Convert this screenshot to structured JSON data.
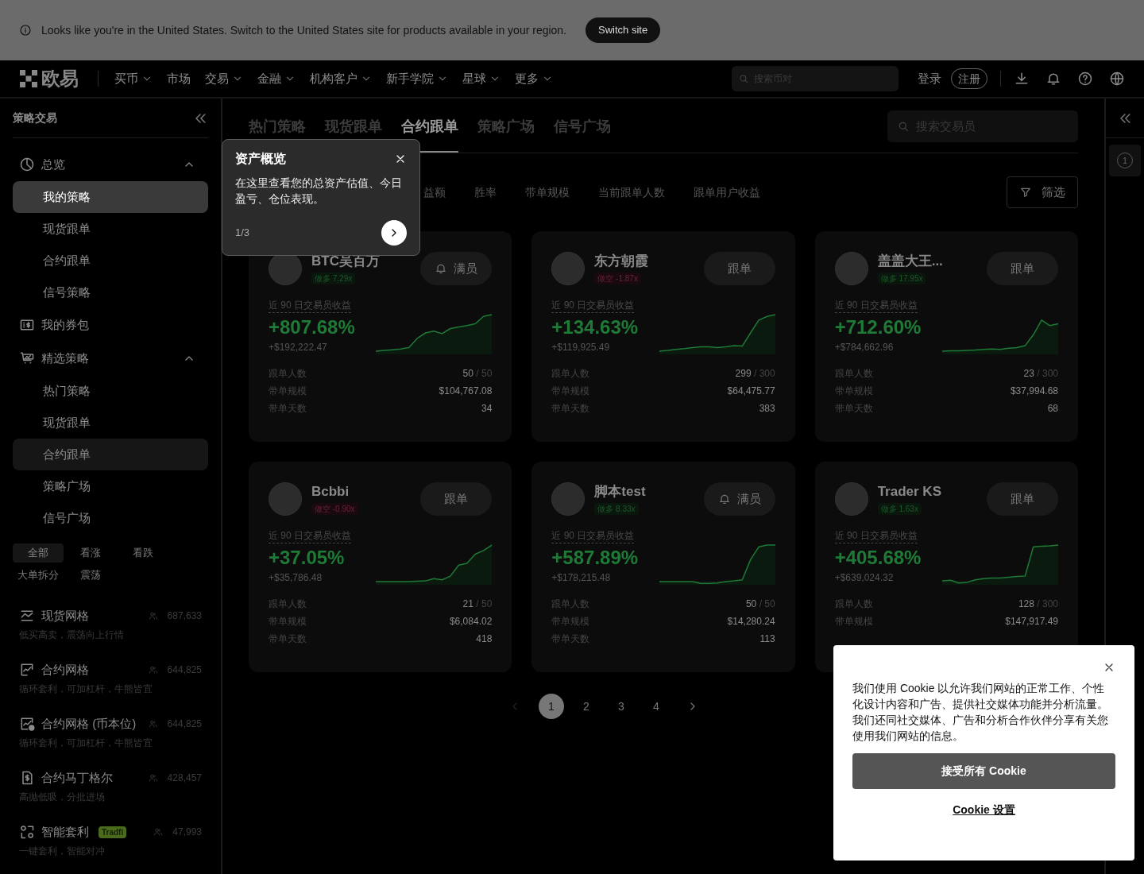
{
  "banner": {
    "message": "Looks like you're in the United States. Switch to the United States site for products available in your region.",
    "button": "Switch site"
  },
  "nav": {
    "logo": "欧易",
    "items": [
      {
        "label": "买币",
        "has_menu": true
      },
      {
        "label": "市场",
        "has_menu": false
      },
      {
        "label": "交易",
        "has_menu": true
      },
      {
        "label": "金融",
        "has_menu": true
      },
      {
        "label": "机构客户",
        "has_menu": true
      },
      {
        "label": "新手学院",
        "has_menu": true
      },
      {
        "label": "星球",
        "has_menu": true
      },
      {
        "label": "更多",
        "has_menu": true
      }
    ],
    "search": {
      "placeholder": "搜索币对"
    },
    "login": "登录",
    "register": "注册"
  },
  "sidebar": {
    "title": "策略交易",
    "groups": [
      {
        "label": "总览",
        "expanded": true,
        "children": [
          {
            "label": "我的策略",
            "selected": false,
            "spotlight": true
          },
          {
            "label": "现货跟单",
            "selected": false,
            "spotlight": false
          },
          {
            "label": "合约跟单",
            "selected": false,
            "spotlight": false
          },
          {
            "label": "信号策略",
            "selected": false,
            "spotlight": false
          }
        ]
      },
      {
        "label": "我的券包"
      },
      {
        "label": "精选策略",
        "expanded": true,
        "children": [
          {
            "label": "热门策略",
            "selected": false,
            "spotlight": false
          },
          {
            "label": "现货跟单",
            "selected": false,
            "spotlight": false
          },
          {
            "label": "合约跟单",
            "selected": true,
            "spotlight": false
          },
          {
            "label": "策略广场",
            "selected": false,
            "spotlight": false
          },
          {
            "label": "信号广场",
            "selected": false,
            "spotlight": false
          }
        ]
      }
    ],
    "filters": [
      {
        "label": "全部",
        "selected": true
      },
      {
        "label": "看涨",
        "selected": false
      },
      {
        "label": "看跌",
        "selected": false
      },
      {
        "label": "大单拆分",
        "selected": false
      },
      {
        "label": "震荡",
        "selected": false
      }
    ],
    "strategies": [
      {
        "name": "现货网格",
        "users": "687,633",
        "description": "低买高卖，震荡向上行情"
      },
      {
        "name": "合约网格",
        "users": "644,825",
        "description": "循环套利，可加杠杆，牛熊皆宜"
      },
      {
        "name": "合约网格 (币本位)",
        "users": "644,825",
        "description": "循环套利，可加杠杆，牛熊皆宜"
      },
      {
        "name": "合约马丁格尔",
        "users": "428,457",
        "description": "高抛低吸，分批进场"
      },
      {
        "name": "智能套利",
        "tag": "Tradfi",
        "users": "47,993",
        "description": "一键套利，智能对冲"
      }
    ]
  },
  "main": {
    "tabs": [
      {
        "label": "热门策略",
        "selected": false
      },
      {
        "label": "现货跟单",
        "selected": false
      },
      {
        "label": "合约跟单",
        "selected": true
      },
      {
        "label": "策略广场",
        "selected": false
      },
      {
        "label": "信号广场",
        "selected": false
      }
    ],
    "search": {
      "placeholder": "搜索交易员"
    },
    "sort_options": [
      "益额",
      "胜率",
      "带单规模",
      "当前跟单人数",
      "跟单用户收益"
    ],
    "filter_button": "筛选",
    "cards": [
      {
        "name": "BTC吴百万",
        "position": {
          "text": "做多 7.29x",
          "kind": "long"
        },
        "button": {
          "label": "满员",
          "kind": "full"
        },
        "metric_label": "近 90 日交易员收益",
        "percent": "+807.68%",
        "amount": "+$192,222.47",
        "stats": [
          {
            "label": "跟单人数",
            "value": "50",
            "suffix": "/ 50"
          },
          {
            "label": "带单规模",
            "value": "$104,767.08"
          },
          {
            "label": "带单天数",
            "value": "34"
          }
        ]
      },
      {
        "name": "东方朝霞",
        "position": {
          "text": "做空 -1.87x",
          "kind": "short"
        },
        "button": {
          "label": "跟单",
          "kind": "follow"
        },
        "metric_label": "近 90 日交易员收益",
        "percent": "+134.63%",
        "amount": "+$119,925.49",
        "stats": [
          {
            "label": "跟单人数",
            "value": "299",
            "suffix": "/ 300"
          },
          {
            "label": "带单规模",
            "value": "$64,475.77"
          },
          {
            "label": "带单天数",
            "value": "383"
          }
        ]
      },
      {
        "name": "盖盖大王...",
        "position": {
          "text": "做多 17.95x",
          "kind": "long"
        },
        "button": {
          "label": "跟单",
          "kind": "follow"
        },
        "metric_label": "近 90 日交易员收益",
        "percent": "+712.60%",
        "amount": "+$784,662.96",
        "stats": [
          {
            "label": "跟单人数",
            "value": "23",
            "suffix": "/ 300"
          },
          {
            "label": "带单规模",
            "value": "$37,994.68"
          },
          {
            "label": "带单天数",
            "value": "68"
          }
        ]
      },
      {
        "name": "Bcbbi",
        "position": {
          "text": "做空 -0.90x",
          "kind": "short"
        },
        "button": {
          "label": "跟单",
          "kind": "follow"
        },
        "metric_label": "近 90 日交易员收益",
        "percent": "+37.05%",
        "amount": "+$35,786.48",
        "stats": [
          {
            "label": "跟单人数",
            "value": "21",
            "suffix": "/ 50"
          },
          {
            "label": "带单规模",
            "value": "$6,084.02"
          },
          {
            "label": "带单天数",
            "value": "418"
          }
        ]
      },
      {
        "name": "脚本test",
        "position": {
          "text": "做多 8.33x",
          "kind": "long"
        },
        "button": {
          "label": "满员",
          "kind": "full"
        },
        "metric_label": "近 90 日交易员收益",
        "percent": "+587.89%",
        "amount": "+$178,215.48",
        "stats": [
          {
            "label": "跟单人数",
            "value": "50",
            "suffix": "/ 50"
          },
          {
            "label": "带单规模",
            "value": "$14,280.24"
          },
          {
            "label": "带单天数",
            "value": "113"
          }
        ]
      },
      {
        "name": "Trader KS",
        "position": {
          "text": "做多 1.63x",
          "kind": "long"
        },
        "button": {
          "label": "跟单",
          "kind": "follow"
        },
        "metric_label": "近 90 日交易员收益",
        "percent": "+405.68%",
        "amount": "+$639,024.32",
        "stats": [
          {
            "label": "跟单人数",
            "value": "128",
            "suffix": "/ 300"
          },
          {
            "label": "带单规模",
            "value": "$147,917.49"
          }
        ]
      }
    ],
    "pagination": {
      "prev_disabled": true,
      "pages": [
        {
          "label": "1",
          "selected": true
        },
        {
          "label": "2",
          "selected": false
        },
        {
          "label": "3",
          "selected": false
        },
        {
          "label": "4",
          "selected": false
        }
      ]
    }
  },
  "right_rail": {
    "badge": "1"
  },
  "tour_tooltip": {
    "title": "资产概览",
    "body": "在这里查看您的总资产估值、今日盈亏、仓位表现。",
    "step": "1/3"
  },
  "cookie_dialog": {
    "text": "我们使用 Cookie 以允许我们网站的正常工作、个性化设计内容和广告、提供社交媒体功能并分析流量。我们还同社交媒体、广告和分析合作伙伴分享有关您使用我们网站的信息。",
    "accept": "接受所有 Cookie",
    "settings": "Cookie 设置"
  }
}
